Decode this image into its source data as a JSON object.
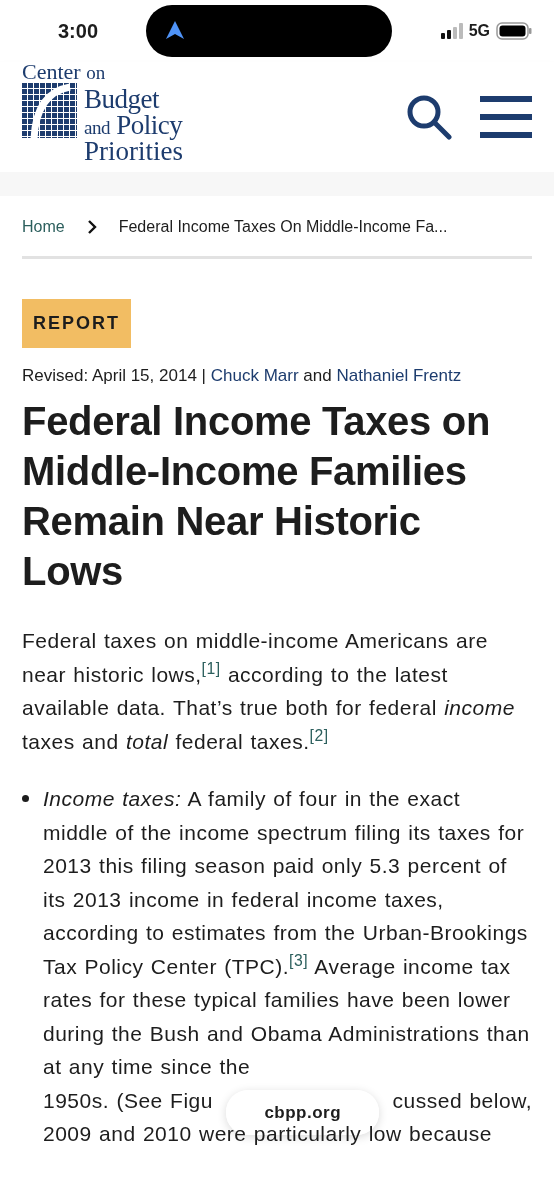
{
  "status_bar": {
    "time": "3:00",
    "network": "5G"
  },
  "header": {
    "logo": {
      "line_1": "Center",
      "line_1_small": "on",
      "line_2": "Budget",
      "line_3_small": "and",
      "line_3": "Policy",
      "line_4": "Priorities"
    }
  },
  "breadcrumb": [
    {
      "label": "Home",
      "kind": "link"
    },
    {
      "label": "Federal Income Taxes On Middle-Income Fa...",
      "kind": "current"
    }
  ],
  "tag": "REPORT",
  "byline": {
    "revised": "Revised: April 15, 2014 |",
    "authors": [
      "Chuck Marr",
      "Nathaniel Frentz"
    ],
    "joiner": "and"
  },
  "title": "Federal Income Taxes on Middle-Income Families Remain Near Historic Lows",
  "intro": "Federal taxes on middle-income Americans are near historic lows,$^{[1]}$ according to the latest available data.  That’s true both for federal *income* taxes and *total* federal taxes.$^{[2]}$",
  "bullet": {
    "text": "*Income taxes:*  A family of four in the exact middle of the income spectrum filing its taxes for 2013 this filing season paid only 5.3 percent of its 2013 income in federal income taxes, according to estimates from the Urban-Brookings Tax Policy Center (TPC).$^{[3]}$  Average income tax rates for these typical families have been lower during the Bush and Obama Administrations than at any time since the",
    "covered_line_left": "1950s.  (See Figu",
    "covered_line_right": "cussed below,",
    "last_line": "2009 and 2010 were particularly low because"
  },
  "url_bar": {
    "url": "cbpp.org"
  }
}
